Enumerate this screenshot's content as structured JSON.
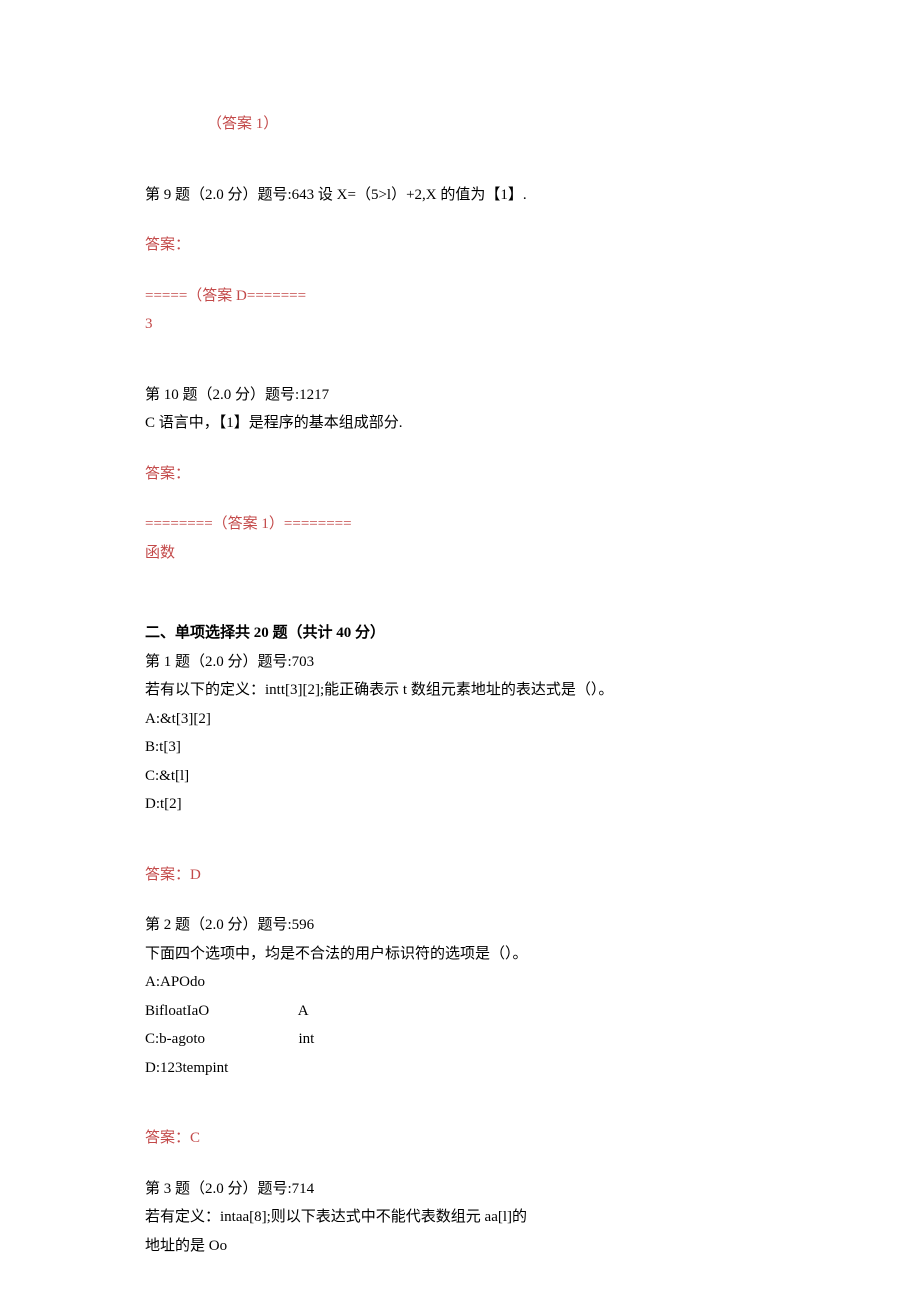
{
  "line1": "（答案 1）",
  "q9": {
    "header": "第 9 题（2.0 分）题号:643 设 X=（5>l）+2,X 的值为【1】.",
    "answer_label": "答案：",
    "answer_sep": "=====（答案 D=======",
    "answer_value": "3"
  },
  "q10": {
    "header": "第 10 题（2.0 分）题号:1217",
    "body": "C 语言中，【1】是程序的基本组成部分.",
    "answer_label": "答案：",
    "answer_sep": "========（答案 1）========",
    "answer_value": "函数"
  },
  "section2": {
    "title": "二、单项选择共 20 题（共计 40 分）",
    "q1": {
      "header": "第 1 题（2.0 分）题号:703",
      "body": "若有以下的定义：intt[3][2];能正确表示 t 数组元素地址的表达式是（）。",
      "optA": "A:&t[3][2]",
      "optB": "B:t[3]",
      "optC": "C:&t[l]",
      "optD": "D:t[2]",
      "answer": "答案：D"
    },
    "q2": {
      "header": "第 2 题（2.0 分）题号:596",
      "body": "下面四个选项中，均是不合法的用户标识符的选项是（）。",
      "optA": "A:APOdo",
      "optB_left": "BifloatIaO",
      "optB_right": "A",
      "optC_left": "C:b-agoto",
      "optC_right": "int",
      "optD": "D:123tempint",
      "answer": "答案：C"
    },
    "q3": {
      "header": "第 3 题（2.0 分）题号:714",
      "body1": "若有定义：intaa[8];则以下表达式中不能代表数组元 aa[l]的",
      "body2": "地址的是 Oo"
    }
  }
}
